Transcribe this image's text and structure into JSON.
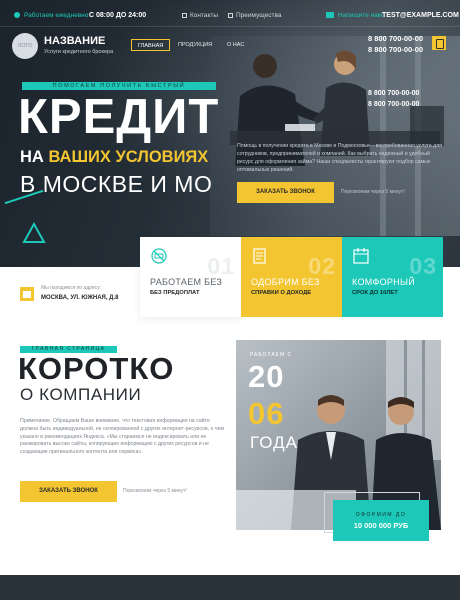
{
  "topbar": {
    "hours_label": "Работаем ежедневно:",
    "hours_value": "С 08:00 ДО 24:00",
    "link_1": "Контакты",
    "link_2": "Преимущества",
    "email_label": "Напишите нам:",
    "email_value": "TEST@EXAMPLE.COM"
  },
  "header": {
    "logo_text": "ЛОГО",
    "brand": "НАЗВАНИЕ",
    "tagline": "Услуги кредитного брокера",
    "nav": [
      "ГЛАВНАЯ",
      "ПРОДУКЦИЯ",
      "О НАС"
    ],
    "phone_1": "8 800 700-00-00",
    "phone_2": "8 800 700-00-00"
  },
  "hero": {
    "eyebrow": "ПОМОГАЕМ ПОЛУЧИТЬ БЫСТРЫЙ",
    "title": "КРЕДИТ",
    "subtitle_prefix": "НА",
    "subtitle_highlight": "ВАШИХ УСЛОВИЯХ",
    "subtitle_line_3": "В МОСКВЕ И МО",
    "phone_overlay_1": "8 800 700-00-00",
    "phone_overlay_2": "8 800 700-00-00",
    "description": "Помощь в получении кредита в Москве и Подмосковье – востребованная услуга для сотрудников, предпринимателей и компаний. Как выбрать надежный и удобный ресурс для оформления займа? Наши специалисты гарантируют подбор самых оптимальных решений.",
    "button": "ЗАКАЗАТЬ ЗВОНОК",
    "button_note": "Перезвоним через 5 минут!"
  },
  "address": {
    "label": "Мы находимся по адресу:",
    "value": "МОСКВА, УЛ. ЮЖНАЯ, Д.8"
  },
  "features": [
    {
      "num": "01",
      "title": "РАБОТАЕМ БЕЗ",
      "sub": "БЕЗ ПРЕДОПЛАТ",
      "icon": "no-prepay-icon"
    },
    {
      "num": "02",
      "title": "ОДОБРИМ БЕЗ",
      "sub": "СПРАВКИ О ДОХОДЕ",
      "icon": "document-icon"
    },
    {
      "num": "03",
      "title": "КОМФОРНЫЙ",
      "sub": "СРОК ДО 10ЛЕТ",
      "icon": "calendar-icon"
    }
  ],
  "about": {
    "eyebrow": "ГЛАВНАЯ СТРАНИЦА",
    "title": "КОРОТКО",
    "subtitle": "О КОМПАНИИ",
    "text": "Примечание. Обращаем Ваше внимание, что текстовая информация на сайте должна быть индивидуальной, не скопированной с других интернет-ресурсов, о чем указано в рекомендациях Яндекса. «Мы стараемся не индексировать или не ранжировать высоко сайты, копирующие информацию с других ресурсов и не создающие оригинального контента или сервиса».",
    "button": "ЗАКАЗАТЬ ЗВОНОК",
    "button_note": "Перезвоним через 5 минут!",
    "year_label": "РАБОТАЕМ С",
    "year_a": "20",
    "year_b": "06",
    "year_word": "ГОДА",
    "card_label": "ОФОРМИМ ДО",
    "card_value": "10 000 000 РУБ"
  },
  "colors": {
    "accent_teal": "#1ec8b8",
    "accent_yellow": "#f3c530",
    "dark": "#1f2328"
  }
}
